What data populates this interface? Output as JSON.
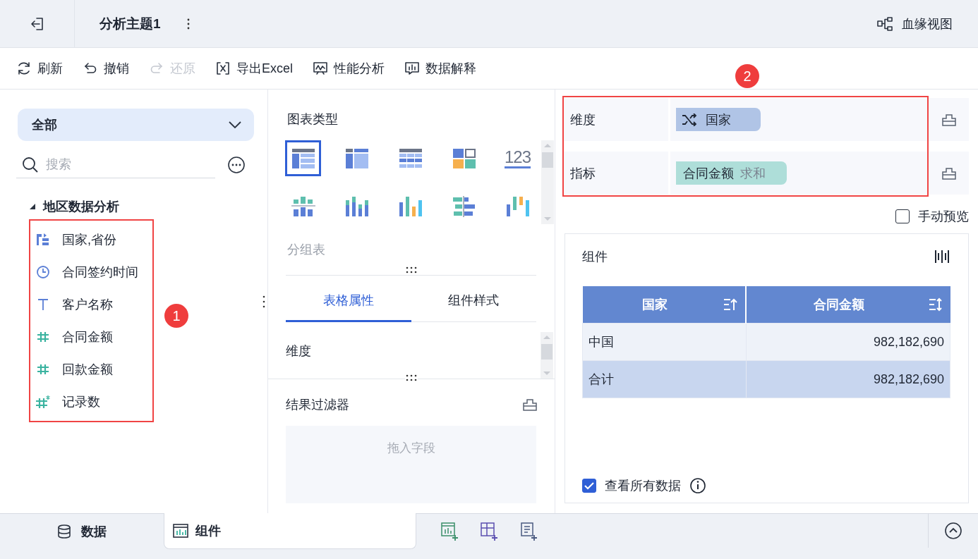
{
  "header": {
    "title": "分析主题1",
    "lineage_button": "血缘视图"
  },
  "toolbar": [
    {
      "label": "刷新",
      "kind": "refresh",
      "disabled": false
    },
    {
      "label": "撤销",
      "kind": "undo",
      "disabled": false
    },
    {
      "label": "还原",
      "kind": "redo",
      "disabled": true
    },
    {
      "label": "导出Excel",
      "kind": "export",
      "disabled": false
    },
    {
      "label": "性能分析",
      "kind": "performance",
      "disabled": false
    },
    {
      "label": "数据解释",
      "kind": "explain",
      "disabled": false
    }
  ],
  "data_panel": {
    "scope": "全部",
    "search": {
      "placeholder": "搜索"
    },
    "annotation": "1",
    "tree": [
      {
        "label": "地区数据分析",
        "expanded": true,
        "children": [
          {
            "label": "国家,省份",
            "kind": "hierarchy"
          },
          {
            "label": "合同签约时间",
            "kind": "time"
          },
          {
            "label": "客户名称",
            "kind": "text"
          },
          {
            "label": "合同金额",
            "kind": "number"
          },
          {
            "label": "回款金额",
            "kind": "number"
          },
          {
            "label": "记录数",
            "kind": "count"
          }
        ]
      }
    ]
  },
  "config_panel": {
    "chart_type_title": "图表类型",
    "chart_types": [
      {
        "kind": "group_table",
        "selected": true
      },
      {
        "kind": "crosstab",
        "selected": false
      },
      {
        "kind": "detail_table",
        "selected": false
      },
      {
        "kind": "card_grid",
        "selected": false
      },
      {
        "kind": "kpi",
        "label": "123",
        "selected": false
      },
      {
        "kind": "dot_column",
        "selected": false
      },
      {
        "kind": "stacked_column",
        "selected": false
      },
      {
        "kind": "column",
        "selected": false
      },
      {
        "kind": "compare_bar",
        "selected": false
      },
      {
        "kind": "range_column",
        "selected": false
      }
    ],
    "selected_chart_name": "分组表",
    "tabs": [
      {
        "label": "表格属性",
        "selected": true
      },
      {
        "label": "组件样式",
        "selected": false
      }
    ],
    "properties": [
      "维度"
    ],
    "filter": {
      "title": "结果过滤器",
      "placeholder": "拖入字段"
    }
  },
  "fields_panel": {
    "annotation": "2",
    "rows": [
      {
        "label": "维度",
        "kind": "dimension",
        "chips": [
          {
            "label": "国家"
          }
        ]
      },
      {
        "label": "指标",
        "kind": "metric",
        "chips": [
          {
            "label": "合同金额",
            "aggregation": "求和"
          }
        ]
      }
    ],
    "manual_preview": {
      "label": "手动预览",
      "checked": false
    }
  },
  "preview": {
    "title": "组件",
    "columns": [
      {
        "label": "国家",
        "sorted": true
      },
      {
        "label": "合同金额",
        "sorted": false
      }
    ],
    "rows": [
      {
        "kind": "data",
        "cells": [
          "中国",
          "982,182,690"
        ]
      },
      {
        "kind": "total",
        "cells": [
          "合计",
          "982,182,690"
        ]
      }
    ],
    "view_all": {
      "label": "查看所有数据",
      "checked": true
    }
  },
  "bottom_tabs": [
    {
      "label": "数据",
      "kind": "data",
      "selected": false
    },
    {
      "label": "组件",
      "kind": "component",
      "selected": true
    }
  ]
}
